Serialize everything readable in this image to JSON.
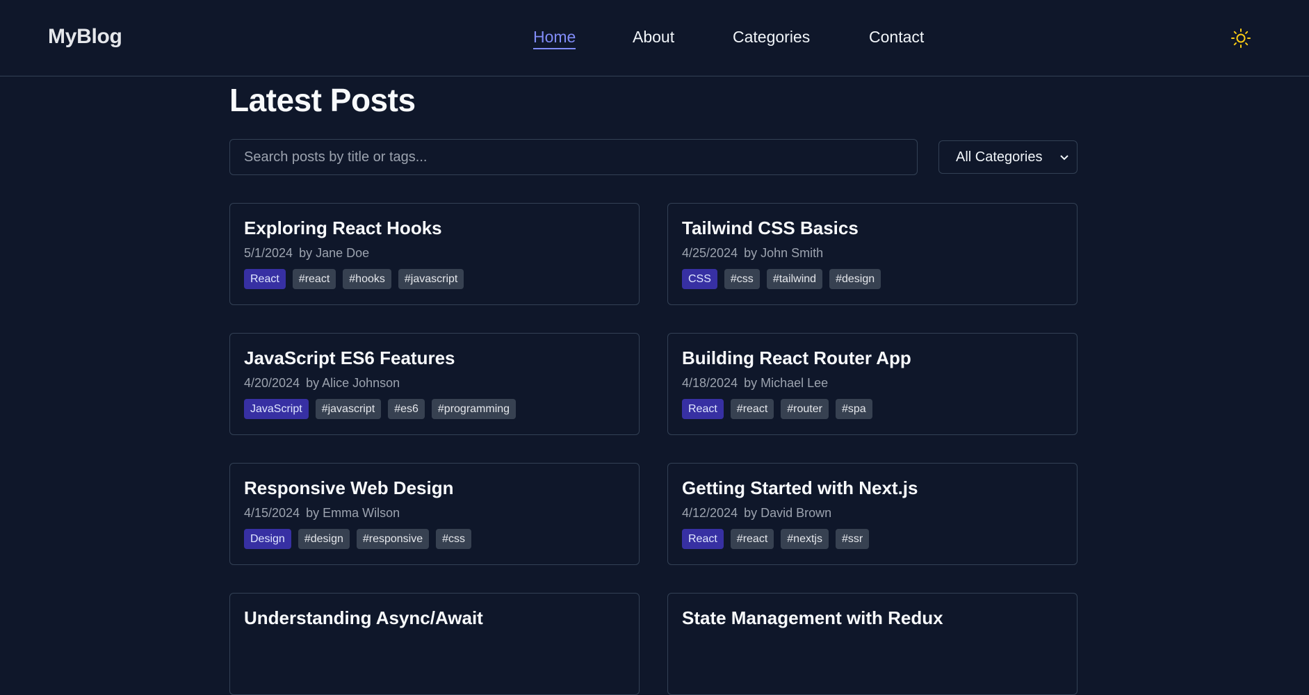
{
  "site": {
    "logo": "MyBlog"
  },
  "nav": {
    "items": [
      {
        "label": "Home",
        "active": true
      },
      {
        "label": "About",
        "active": false
      },
      {
        "label": "Categories",
        "active": false
      },
      {
        "label": "Contact",
        "active": false
      }
    ],
    "theme_icon": "sun-icon"
  },
  "main": {
    "title": "Latest Posts",
    "search_placeholder": "Search posts by title or tags...",
    "category_select": {
      "selected": "All Categories"
    }
  },
  "posts": [
    {
      "title": "Exploring React Hooks",
      "date": "5/1/2024",
      "author": "by Jane Doe",
      "category": "React",
      "tags": [
        "#react",
        "#hooks",
        "#javascript"
      ]
    },
    {
      "title": "Tailwind CSS Basics",
      "date": "4/25/2024",
      "author": "by John Smith",
      "category": "CSS",
      "tags": [
        "#css",
        "#tailwind",
        "#design"
      ]
    },
    {
      "title": "JavaScript ES6 Features",
      "date": "4/20/2024",
      "author": "by Alice Johnson",
      "category": "JavaScript",
      "tags": [
        "#javascript",
        "#es6",
        "#programming"
      ]
    },
    {
      "title": "Building React Router App",
      "date": "4/18/2024",
      "author": "by Michael Lee",
      "category": "React",
      "tags": [
        "#react",
        "#router",
        "#spa"
      ]
    },
    {
      "title": "Responsive Web Design",
      "date": "4/15/2024",
      "author": "by Emma Wilson",
      "category": "Design",
      "tags": [
        "#design",
        "#responsive",
        "#css"
      ]
    },
    {
      "title": "Getting Started with Next.js",
      "date": "4/12/2024",
      "author": "by David Brown",
      "category": "React",
      "tags": [
        "#react",
        "#nextjs",
        "#ssr"
      ]
    },
    {
      "title": "Understanding Async/Await",
      "date": "",
      "author": "",
      "category": "",
      "tags": []
    },
    {
      "title": "State Management with Redux",
      "date": "",
      "author": "",
      "category": "",
      "tags": []
    }
  ],
  "colors": {
    "background": "#0f172a",
    "accent": "#818cf8",
    "category_badge": "#3730a3",
    "tag_badge": "#374151",
    "sun": "#facc15"
  }
}
